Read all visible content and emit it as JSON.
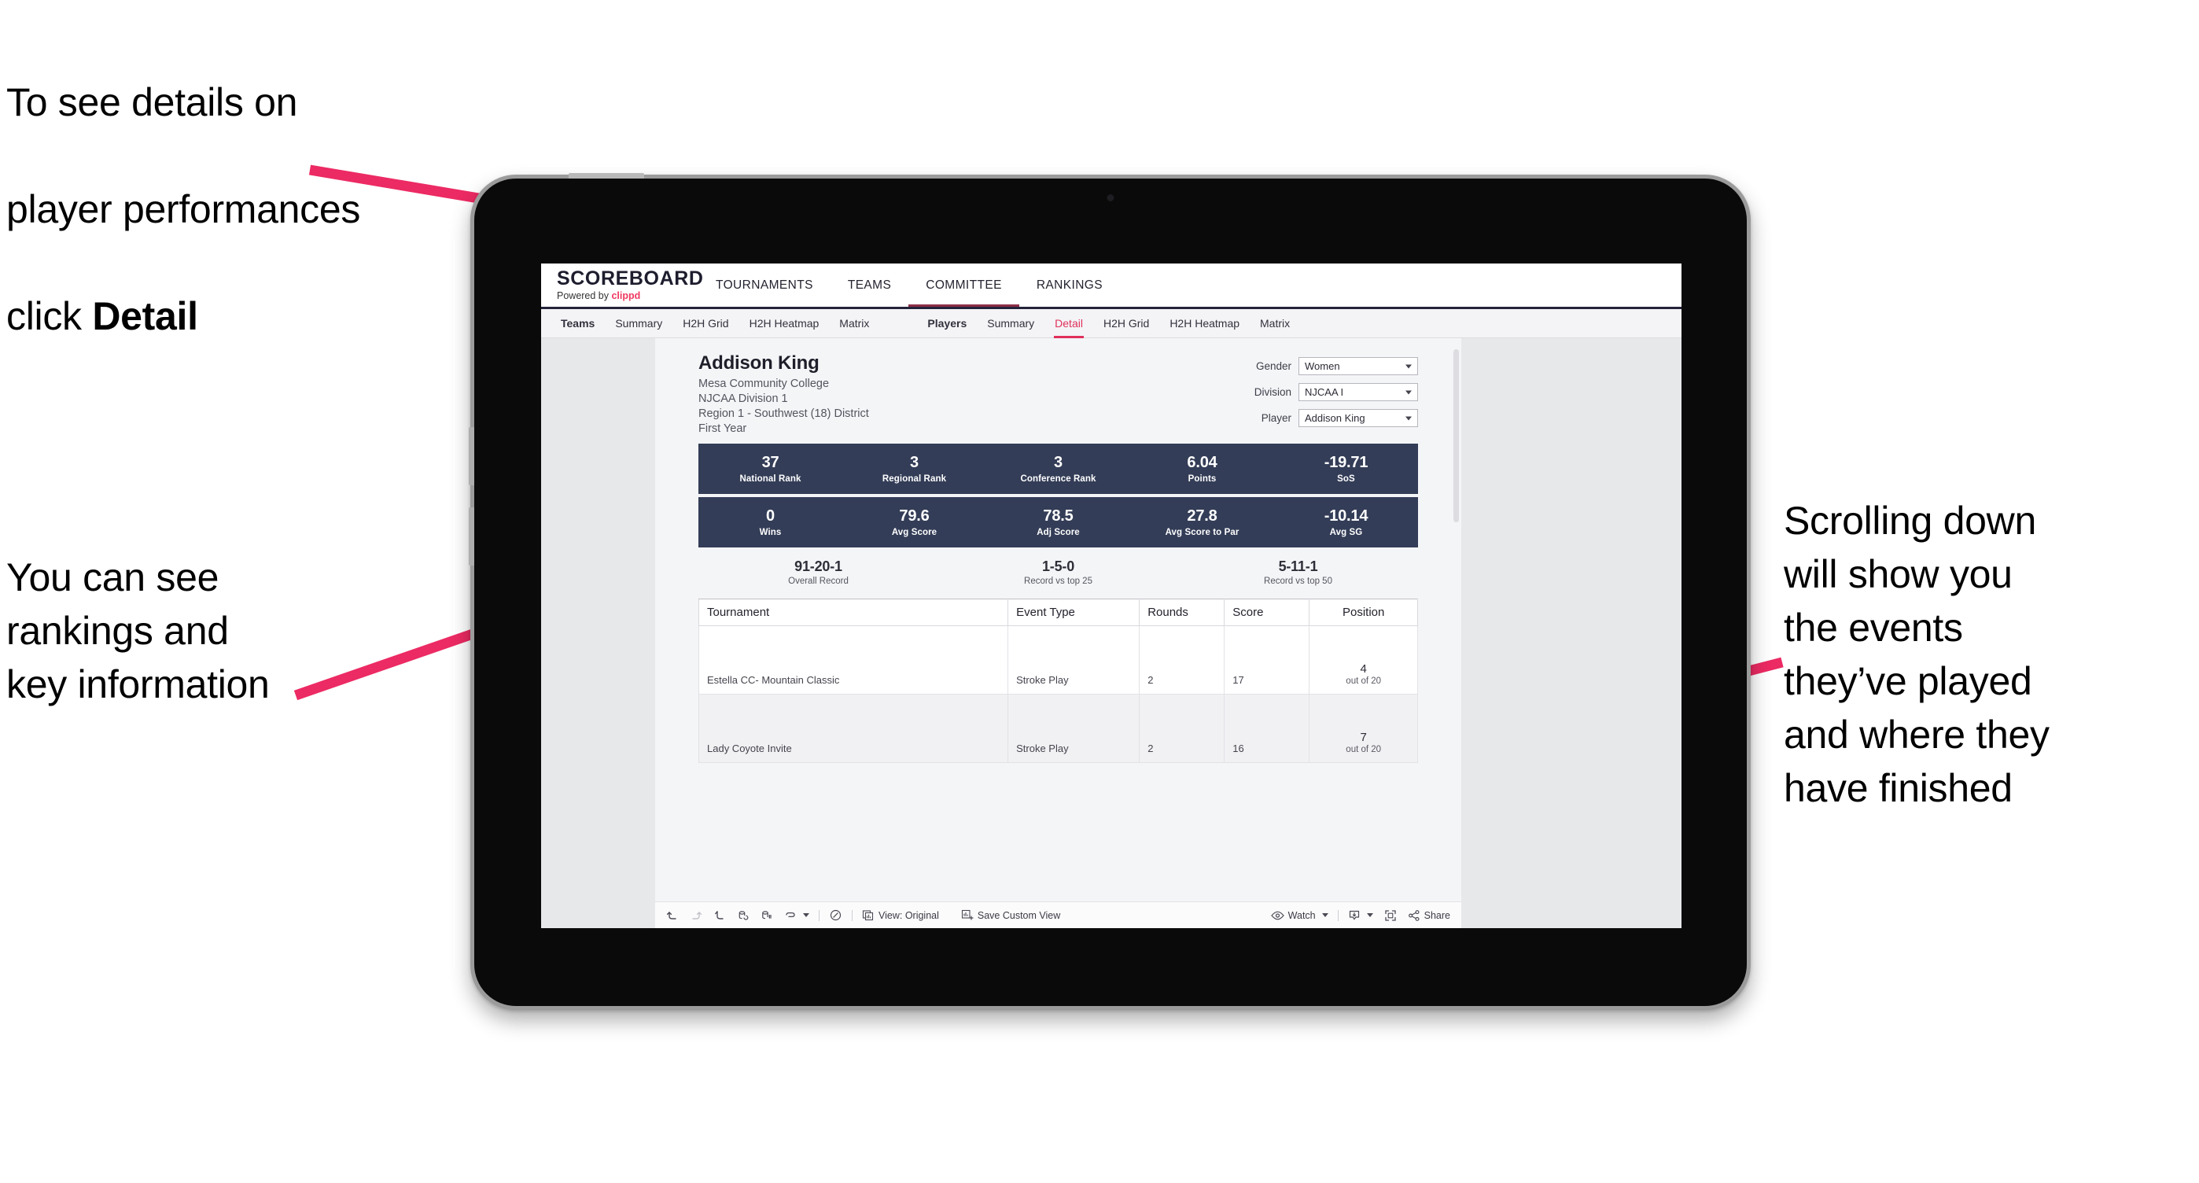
{
  "annotations": {
    "top_left_line1": "To see details on",
    "top_left_line2": "player performances",
    "top_left_line3_prefix": "click ",
    "top_left_line3_bold": "Detail",
    "mid_left": "You can see\nrankings and\nkey information",
    "right": "Scrolling down\nwill show you\nthe events\nthey’ve played\nand where they\nhave finished",
    "arrow_color": "#ec2a63"
  },
  "app": {
    "brand": {
      "title": "SCOREBOARD",
      "powered_prefix": "Powered by ",
      "powered_brand": "clippd"
    },
    "top_nav": [
      {
        "label": "TOURNAMENTS",
        "active": false
      },
      {
        "label": "TEAMS",
        "active": false
      },
      {
        "label": "COMMITTEE",
        "active": true
      },
      {
        "label": "RANKINGS",
        "active": false
      }
    ],
    "sub_nav_left": [
      {
        "label": "Teams",
        "bold": true,
        "active": false
      },
      {
        "label": "Summary",
        "bold": false,
        "active": false
      },
      {
        "label": "H2H Grid",
        "bold": false,
        "active": false
      },
      {
        "label": "H2H Heatmap",
        "bold": false,
        "active": false
      },
      {
        "label": "Matrix",
        "bold": false,
        "active": false
      }
    ],
    "sub_nav_right": [
      {
        "label": "Players",
        "bold": true,
        "active": false
      },
      {
        "label": "Summary",
        "bold": false,
        "active": false
      },
      {
        "label": "Detail",
        "bold": false,
        "active": true
      },
      {
        "label": "H2H Grid",
        "bold": false,
        "active": false
      },
      {
        "label": "H2H Heatmap",
        "bold": false,
        "active": false
      },
      {
        "label": "Matrix",
        "bold": false,
        "active": false
      }
    ]
  },
  "player": {
    "name": "Addison King",
    "college": "Mesa Community College",
    "division": "NJCAA Division 1",
    "region": "Region 1 - Southwest (18) District",
    "year": "First Year"
  },
  "filters": [
    {
      "label": "Gender",
      "value": "Women"
    },
    {
      "label": "Division",
      "value": "NJCAA I"
    },
    {
      "label": "Player",
      "value": "Addison King"
    }
  ],
  "stat_bar_1": [
    {
      "value": "37",
      "label": "National Rank"
    },
    {
      "value": "3",
      "label": "Regional Rank"
    },
    {
      "value": "3",
      "label": "Conference Rank"
    },
    {
      "value": "6.04",
      "label": "Points"
    },
    {
      "value": "-19.71",
      "label": "SoS"
    }
  ],
  "stat_bar_2": [
    {
      "value": "0",
      "label": "Wins"
    },
    {
      "value": "79.6",
      "label": "Avg Score"
    },
    {
      "value": "78.5",
      "label": "Adj Score"
    },
    {
      "value": "27.8",
      "label": "Avg Score to Par"
    },
    {
      "value": "-10.14",
      "label": "Avg SG"
    }
  ],
  "records": [
    {
      "value": "91-20-1",
      "label": "Overall Record"
    },
    {
      "value": "1-5-0",
      "label": "Record vs top 25"
    },
    {
      "value": "5-11-1",
      "label": "Record vs top 50"
    }
  ],
  "table": {
    "headers": [
      "Tournament",
      "Event Type",
      "Rounds",
      "Score",
      "Position"
    ],
    "rows": [
      {
        "tournament": "Estella CC- Mountain Classic",
        "event_type": "Stroke Play",
        "rounds": "2",
        "score": "17",
        "position_num": "4",
        "position_sub": "out of 20"
      },
      {
        "tournament": "Lady Coyote Invite",
        "event_type": "Stroke Play",
        "rounds": "2",
        "score": "16",
        "position_num": "7",
        "position_sub": "out of 20"
      }
    ]
  },
  "toolbar": {
    "view_label": "View: Original",
    "save_label": "Save Custom View",
    "watch_label": "Watch",
    "share_label": "Share"
  },
  "colors": {
    "accent_pink": "#e0315a",
    "stat_bar_bg": "#333d57",
    "header_underline": "#23233b"
  }
}
